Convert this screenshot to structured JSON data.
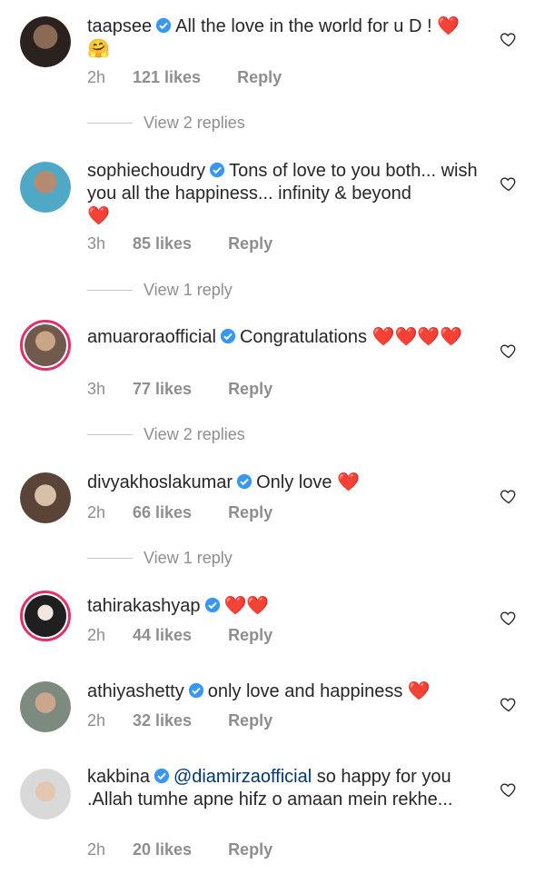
{
  "comments": [
    {
      "username": "taapsee",
      "text": "All the love in the world for u D ! ",
      "emoji": "❤️",
      "extra": "🤗",
      "time": "2h",
      "likes": "121 likes",
      "reply": "Reply",
      "replies": "View 2 replies"
    },
    {
      "username": "sophiechoudry",
      "text": "Tons of love to you both... wish you all the happiness... infinity & beyond",
      "emoji": "❤️",
      "time": "3h",
      "likes": "85 likes",
      "reply": "Reply",
      "replies": "View 1 reply"
    },
    {
      "username": "amuaroraofficial",
      "text": "Congratulations ",
      "emoji": "❤️❤️❤️❤️",
      "time": "3h",
      "likes": "77 likes",
      "reply": "Reply",
      "replies": "View 2 replies"
    },
    {
      "username": "divyakhoslakumar",
      "text": "Only love ",
      "emoji": "❤️",
      "time": "2h",
      "likes": "66 likes",
      "reply": "Reply",
      "replies": "View 1 reply"
    },
    {
      "username": "tahirakashyap",
      "text": "",
      "emoji": "❤️❤️",
      "time": "2h",
      "likes": "44 likes",
      "reply": "Reply"
    },
    {
      "username": "athiyashetty",
      "text": "only love and happiness ",
      "emoji": "❤️",
      "time": "2h",
      "likes": "32 likes",
      "reply": "Reply"
    },
    {
      "username": "kakbina",
      "mention": "@diamirzaofficial",
      "text": " so happy for you .Allah tumhe apne hifz o amaan mein rekhe...",
      "time": "2h",
      "likes": "20 likes",
      "reply": "Reply"
    }
  ],
  "colors": {
    "verified": "#3897f0",
    "heart": "#e0162b",
    "muted": "#8e8e8e",
    "story_ring": "#e1306c"
  }
}
